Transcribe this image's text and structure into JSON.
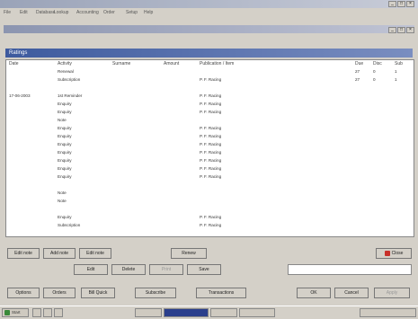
{
  "app_title": "",
  "menu": [
    "File",
    "Edit",
    "Database",
    "Lookup",
    "Accounting",
    "Order",
    "Setup",
    "Help"
  ],
  "inner_title": "",
  "section_title": "Ratings",
  "columns": [
    "Date",
    "Activity",
    "Surname",
    "Amount",
    "Publication / Item",
    "Due",
    "Disc",
    "Sub"
  ],
  "rows": [
    {
      "date": "",
      "activity": "Renewal",
      "ref": "",
      "amount": "",
      "pub": "",
      "due": "27",
      "disc": "0",
      "sub": "1"
    },
    {
      "date": "",
      "activity": "Subscription",
      "ref": "",
      "amount": "",
      "pub": "P. F. Racing",
      "due": "27",
      "disc": "0",
      "sub": "1"
    },
    {
      "date": "",
      "activity": "",
      "ref": "",
      "amount": "",
      "pub": "",
      "due": "",
      "disc": "",
      "sub": ""
    },
    {
      "date": "17-06-2003",
      "activity": "1st Reminder",
      "ref": "",
      "amount": "",
      "pub": "P. F. Racing",
      "due": "",
      "disc": "",
      "sub": ""
    },
    {
      "date": "",
      "activity": "Enquiry",
      "ref": "",
      "amount": "",
      "pub": "P. F. Racing",
      "due": "",
      "disc": "",
      "sub": ""
    },
    {
      "date": "",
      "activity": "Enquiry",
      "ref": "",
      "amount": "",
      "pub": "P. F. Racing",
      "due": "",
      "disc": "",
      "sub": ""
    },
    {
      "date": "",
      "activity": "Note",
      "ref": "",
      "amount": "",
      "pub": "",
      "due": "",
      "disc": "",
      "sub": ""
    },
    {
      "date": "",
      "activity": "Enquiry",
      "ref": "",
      "amount": "",
      "pub": "P. F. Racing",
      "due": "",
      "disc": "",
      "sub": ""
    },
    {
      "date": "",
      "activity": "Enquiry",
      "ref": "",
      "amount": "",
      "pub": "P. F. Racing",
      "due": "",
      "disc": "",
      "sub": ""
    },
    {
      "date": "",
      "activity": "Enquiry",
      "ref": "",
      "amount": "",
      "pub": "P. F. Racing",
      "due": "",
      "disc": "",
      "sub": ""
    },
    {
      "date": "",
      "activity": "Enquiry",
      "ref": "",
      "amount": "",
      "pub": "P. F. Racing",
      "due": "",
      "disc": "",
      "sub": ""
    },
    {
      "date": "",
      "activity": "Enquiry",
      "ref": "",
      "amount": "",
      "pub": "P. F. Racing",
      "due": "",
      "disc": "",
      "sub": ""
    },
    {
      "date": "",
      "activity": "Enquiry",
      "ref": "",
      "amount": "",
      "pub": "P. F. Racing",
      "due": "",
      "disc": "",
      "sub": ""
    },
    {
      "date": "",
      "activity": "Enquiry",
      "ref": "",
      "amount": "",
      "pub": "P. F. Racing",
      "due": "",
      "disc": "",
      "sub": ""
    },
    {
      "date": "",
      "activity": "",
      "ref": "",
      "amount": "",
      "pub": "",
      "due": "",
      "disc": "",
      "sub": ""
    },
    {
      "date": "",
      "activity": "Note",
      "ref": "",
      "amount": "",
      "pub": "",
      "due": "",
      "disc": "",
      "sub": ""
    },
    {
      "date": "",
      "activity": "Note",
      "ref": "",
      "amount": "",
      "pub": "",
      "due": "",
      "disc": "",
      "sub": ""
    },
    {
      "date": "",
      "activity": "",
      "ref": "",
      "amount": "",
      "pub": "",
      "due": "",
      "disc": "",
      "sub": ""
    },
    {
      "date": "",
      "activity": "Enquiry",
      "ref": "",
      "amount": "",
      "pub": "P. F. Racing",
      "due": "",
      "disc": "",
      "sub": ""
    },
    {
      "date": "",
      "activity": "Subscription",
      "ref": "",
      "amount": "",
      "pub": "P. F. Racing",
      "due": "",
      "disc": "",
      "sub": ""
    }
  ],
  "buttons_row1": [
    "Edit note",
    "Add note",
    "Edit note",
    "Renew"
  ],
  "buttons_row2": [
    "Edit",
    "Delete",
    "Print",
    "Save"
  ],
  "close_label": "Close",
  "buttons_bottom": [
    "Options",
    "Orders",
    "Bill Quick",
    "Subscribe",
    "Transactions",
    "OK",
    "Cancel",
    "Apply"
  ],
  "taskbar": {
    "start": "Start",
    "items": [
      "",
      "",
      "",
      ""
    ],
    "time": ""
  },
  "colors": {
    "section_bar": "#3d5a9e",
    "close_icon": "#c8302a",
    "ok_icon": "#3a8a3a"
  }
}
